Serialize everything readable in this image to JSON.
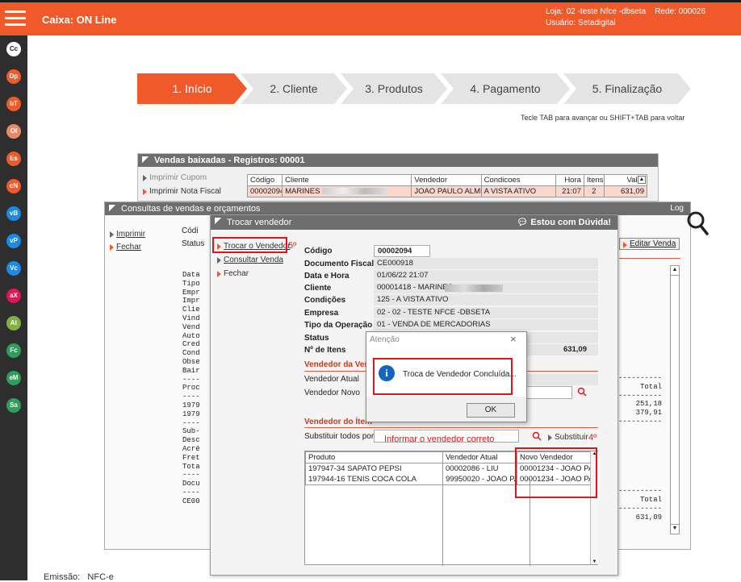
{
  "topbar": {
    "title": "Caixa: ON Line",
    "loja_label": "Loja:",
    "loja_value": "02 -teste Nfce -dbseta",
    "rede_label": "Rede:",
    "rede_value": "000026",
    "usuario_label": "Usuário:",
    "usuario_value": "Setadigital",
    "accent": "#f05a2a"
  },
  "rail": [
    {
      "text": "Cc",
      "color": "#ffffff",
      "fg": "#222222"
    },
    {
      "text": "Dp",
      "color": "#f05a2a",
      "fg": "#ffffff"
    },
    {
      "text": "bT",
      "color": "#f05a2a",
      "fg": "#ffffff"
    },
    {
      "text": "Ol",
      "color": "#e88a6a",
      "fg": "#ffffff"
    },
    {
      "text": "Es",
      "color": "#f05a2a",
      "fg": "#ffffff"
    },
    {
      "text": "cN",
      "color": "#f05a2a",
      "fg": "#ffffff"
    },
    {
      "text": "vB",
      "color": "#1e88e5",
      "fg": "#ffffff"
    },
    {
      "text": "vP",
      "color": "#1e88e5",
      "fg": "#ffffff"
    },
    {
      "text": "Vc",
      "color": "#1e88e5",
      "fg": "#ffffff"
    },
    {
      "text": "aX",
      "color": "#e0155a",
      "fg": "#ffffff"
    },
    {
      "text": "At",
      "color": "#7cb342",
      "fg": "#ffffff"
    },
    {
      "text": "Fc",
      "color": "#2e9e5a",
      "fg": "#ffffff"
    },
    {
      "text": "eM",
      "color": "#2e9e5a",
      "fg": "#ffffff"
    },
    {
      "text": "Sa",
      "color": "#2e9e5a",
      "fg": "#ffffff"
    }
  ],
  "wizard": {
    "steps": [
      "1. Início",
      "2. Cliente",
      "3. Produtos",
      "4. Pagamento",
      "5. Finalização"
    ],
    "hint": "Tecle TAB para avançar ou SHIFT+TAB para voltar"
  },
  "vendas": {
    "title": "Vendas baixadas - Registros: 00001",
    "menu": [
      "Imprimir Cupom",
      "Imprimir Nota Fiscal"
    ],
    "columns": [
      "Código",
      "Cliente",
      "Vendedor",
      "Condicoes",
      "Hora",
      "Itens",
      "Valor"
    ],
    "row": [
      "00002094",
      "MARINES",
      "JOAO PAULO ALME",
      "A VISTA ATIVO",
      "21:07",
      "2",
      "631,09"
    ]
  },
  "consultas": {
    "title": "Consultas de vendas e orçamentos",
    "log": "Log",
    "menu": [
      "Imprimir",
      "Fechar"
    ],
    "partial_labels": [
      "Códi",
      "Status"
    ],
    "editar": "Editar Venda",
    "mono_left": [
      "Data",
      "Tipo",
      "Empr",
      "Impr",
      "Clie",
      "Vind",
      "Vend",
      "Auto",
      "Cred",
      "Cond",
      "Obse",
      "Bair",
      "----",
      "Proc",
      "----",
      "1979",
      "1979",
      "----",
      "Sub-",
      "Desc",
      "Acré",
      "Fret",
      "Tota",
      "",
      "----",
      "Docu",
      "----",
      "CE00"
    ],
    "mono_right": [
      "----------",
      "Total",
      "----------",
      "251,18",
      "379,91",
      "----------",
      "",
      "",
      "",
      "",
      "",
      "",
      "",
      "----------",
      "Total",
      "----------",
      "631,09"
    ]
  },
  "trocar": {
    "title": "Trocar vendedor",
    "duvida": "Estou com Dúvida!",
    "menu": [
      "Trocar o Vendedor",
      "Consultar Venda",
      "Fechar"
    ],
    "step_note_5": "5º",
    "fields": [
      {
        "label": "Código",
        "value": "00002094"
      },
      {
        "label": "Documento Fiscal",
        "value": "CE000918"
      },
      {
        "label": "Data e Hora",
        "value": "01/06/22 21:07"
      },
      {
        "label": "Cliente",
        "value": "00001418 - MARINES"
      },
      {
        "label": "Condições",
        "value": "125 - A VISTA ATIVO"
      },
      {
        "label": "Empresa",
        "value": "02 - 02 - TESTE NFCE -DBSETA"
      },
      {
        "label": "Tipo da Operação",
        "value": "01 - VENDA DE MERCADORIAS"
      },
      {
        "label": "Status",
        "value": ""
      },
      {
        "label": "Nº de Itens",
        "value": "631,09"
      }
    ],
    "sec_vendedor_venda": "Vendedor da Vend",
    "vendedor_atual": "Vendedor Atual",
    "vendedor_novo": "Vendedor Novo",
    "sec_vendedor_item": "Vendedor do Ítem",
    "substituir_todos": "Substituir todos por",
    "substituir_placeholder": "Informar o vendedor correto",
    "substituir_btn": "Substituir",
    "step_note_4": "4º",
    "items_columns": [
      "Produto",
      "Vendedor Atual",
      "Novo Vendedor"
    ],
    "items": [
      [
        "197947-34 SAPATO PEPSI",
        "00002086 - LIU",
        "00001234 - JOAO PAU"
      ],
      [
        "197944-16 TENIS COCA COLA",
        "99950020 - JOAO PAU",
        "00001234 - JOAO PAU"
      ]
    ]
  },
  "atencao": {
    "title": "Atenção",
    "message": "Troca de Vendedor Concluída...",
    "ok": "OK"
  },
  "footer": {
    "emissao_label": "Emissão:",
    "emissao_value": "NFC-e"
  }
}
